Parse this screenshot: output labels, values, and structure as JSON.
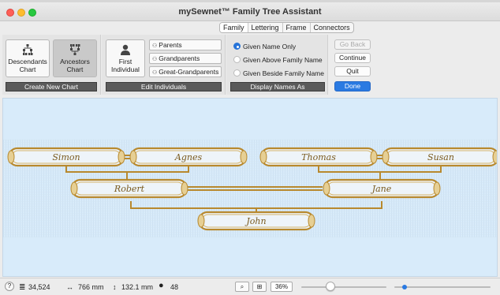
{
  "window": {
    "title": "mySewnet™ Family Tree Assistant"
  },
  "tabs": [
    "Family",
    "Lettering",
    "Frame",
    "Connectors"
  ],
  "chart_types": {
    "descendants": "Descendants Chart",
    "ancestors": "Ancestors Chart",
    "section_label": "Create New Chart"
  },
  "individuals": {
    "first": "First Individual",
    "parents": "Parents",
    "grandparents": "Grandparents",
    "great_grandparents": "Great-Grandparents",
    "section_label": "Edit Individuals"
  },
  "display_names": {
    "options": [
      "Given Name Only",
      "Given Above Family Name",
      "Given Beside Family Name"
    ],
    "selected": "Given Name Only",
    "section_label": "Display Names As"
  },
  "controls": {
    "go_back": "Go Back",
    "continue": "Continue",
    "quit": "Quit",
    "done": "Done"
  },
  "tree": {
    "names": [
      "Simon",
      "Agnes",
      "Thomas",
      "Susan",
      "Robert",
      "Jane",
      "John"
    ]
  },
  "status": {
    "help": "?",
    "stitches": "34,524",
    "width": "766 mm",
    "height": "132.1 mm",
    "colors": "48",
    "zoom": "36%"
  },
  "colors": {
    "accent": "#2a7ae2",
    "frame_gold": "#b8892e",
    "canvas_bg": "#d8ebfa"
  }
}
